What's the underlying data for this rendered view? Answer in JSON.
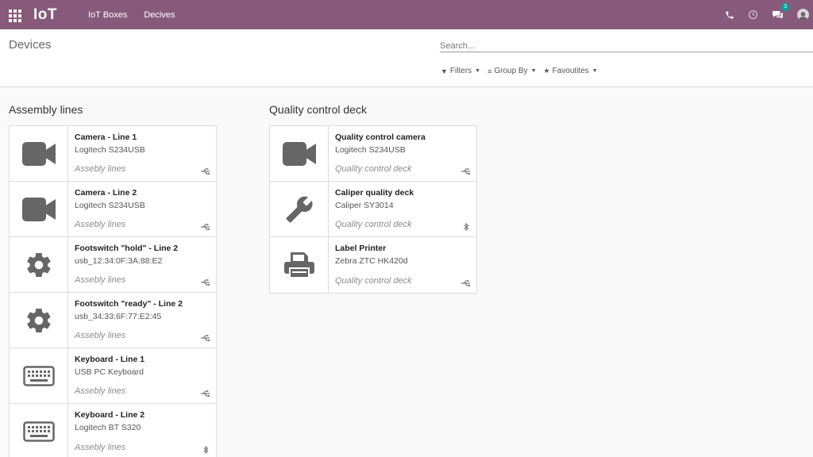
{
  "navbar": {
    "app_name": "IoT",
    "menu": [
      "IoT Boxes",
      "Decives"
    ],
    "chat_badge": "3",
    "color": "#875a7b"
  },
  "control_panel": {
    "breadcrumb": "Devices",
    "search_placeholder": "Search...",
    "filters": [
      {
        "label": "Filters",
        "icon": "filter-icon"
      },
      {
        "label": "Group By",
        "icon": "list-icon"
      },
      {
        "label": "Favoutites",
        "icon": "star-icon"
      }
    ]
  },
  "groups": [
    {
      "title": "Assembly lines",
      "devices": [
        {
          "name": "Camera - Line 1",
          "model": "Logitech S234USB",
          "location": "Assebly lines",
          "icon": "camera-icon",
          "connection": "usb-icon"
        },
        {
          "name": "Camera - Line 2",
          "model": "Logitech S234USB",
          "location": "Assebly lines",
          "icon": "camera-icon",
          "connection": "usb-icon"
        },
        {
          "name": "Footswitch \"hold\" - Line 2",
          "model": "usb_12:34:0F:3A:88:E2",
          "location": "Assebly lines",
          "icon": "gear-icon",
          "connection": "usb-icon"
        },
        {
          "name": "Footswitch \"ready\" - Line 2",
          "model": "usb_34:33:6F:77:E2:45",
          "location": "Assebly lines",
          "icon": "gear-icon",
          "connection": "usb-icon"
        },
        {
          "name": "Keyboard - Line 1",
          "model": "USB PC Keyboard",
          "location": "Assebly lines",
          "icon": "keyboard-icon",
          "connection": "usb-icon"
        },
        {
          "name": "Keyboard - Line 2",
          "model": "Logitech BT S320",
          "location": "Assebly lines",
          "icon": "keyboard-icon",
          "connection": "bluetooth-icon"
        }
      ]
    },
    {
      "title": "Quality control deck",
      "devices": [
        {
          "name": "Quality control camera",
          "model": "Logitech S234USB",
          "location": "Quality control deck",
          "icon": "camera-icon",
          "connection": "usb-icon"
        },
        {
          "name": "Caliper quality deck",
          "model": "Caliper SY3014",
          "location": "Quality control deck",
          "icon": "wrench-icon",
          "connection": "bluetooth-icon"
        },
        {
          "name": "Label Printer",
          "model": "Zebra ZTC HK420d",
          "location": "Quality control deck",
          "icon": "printer-icon",
          "connection": "usb-icon"
        }
      ]
    }
  ]
}
